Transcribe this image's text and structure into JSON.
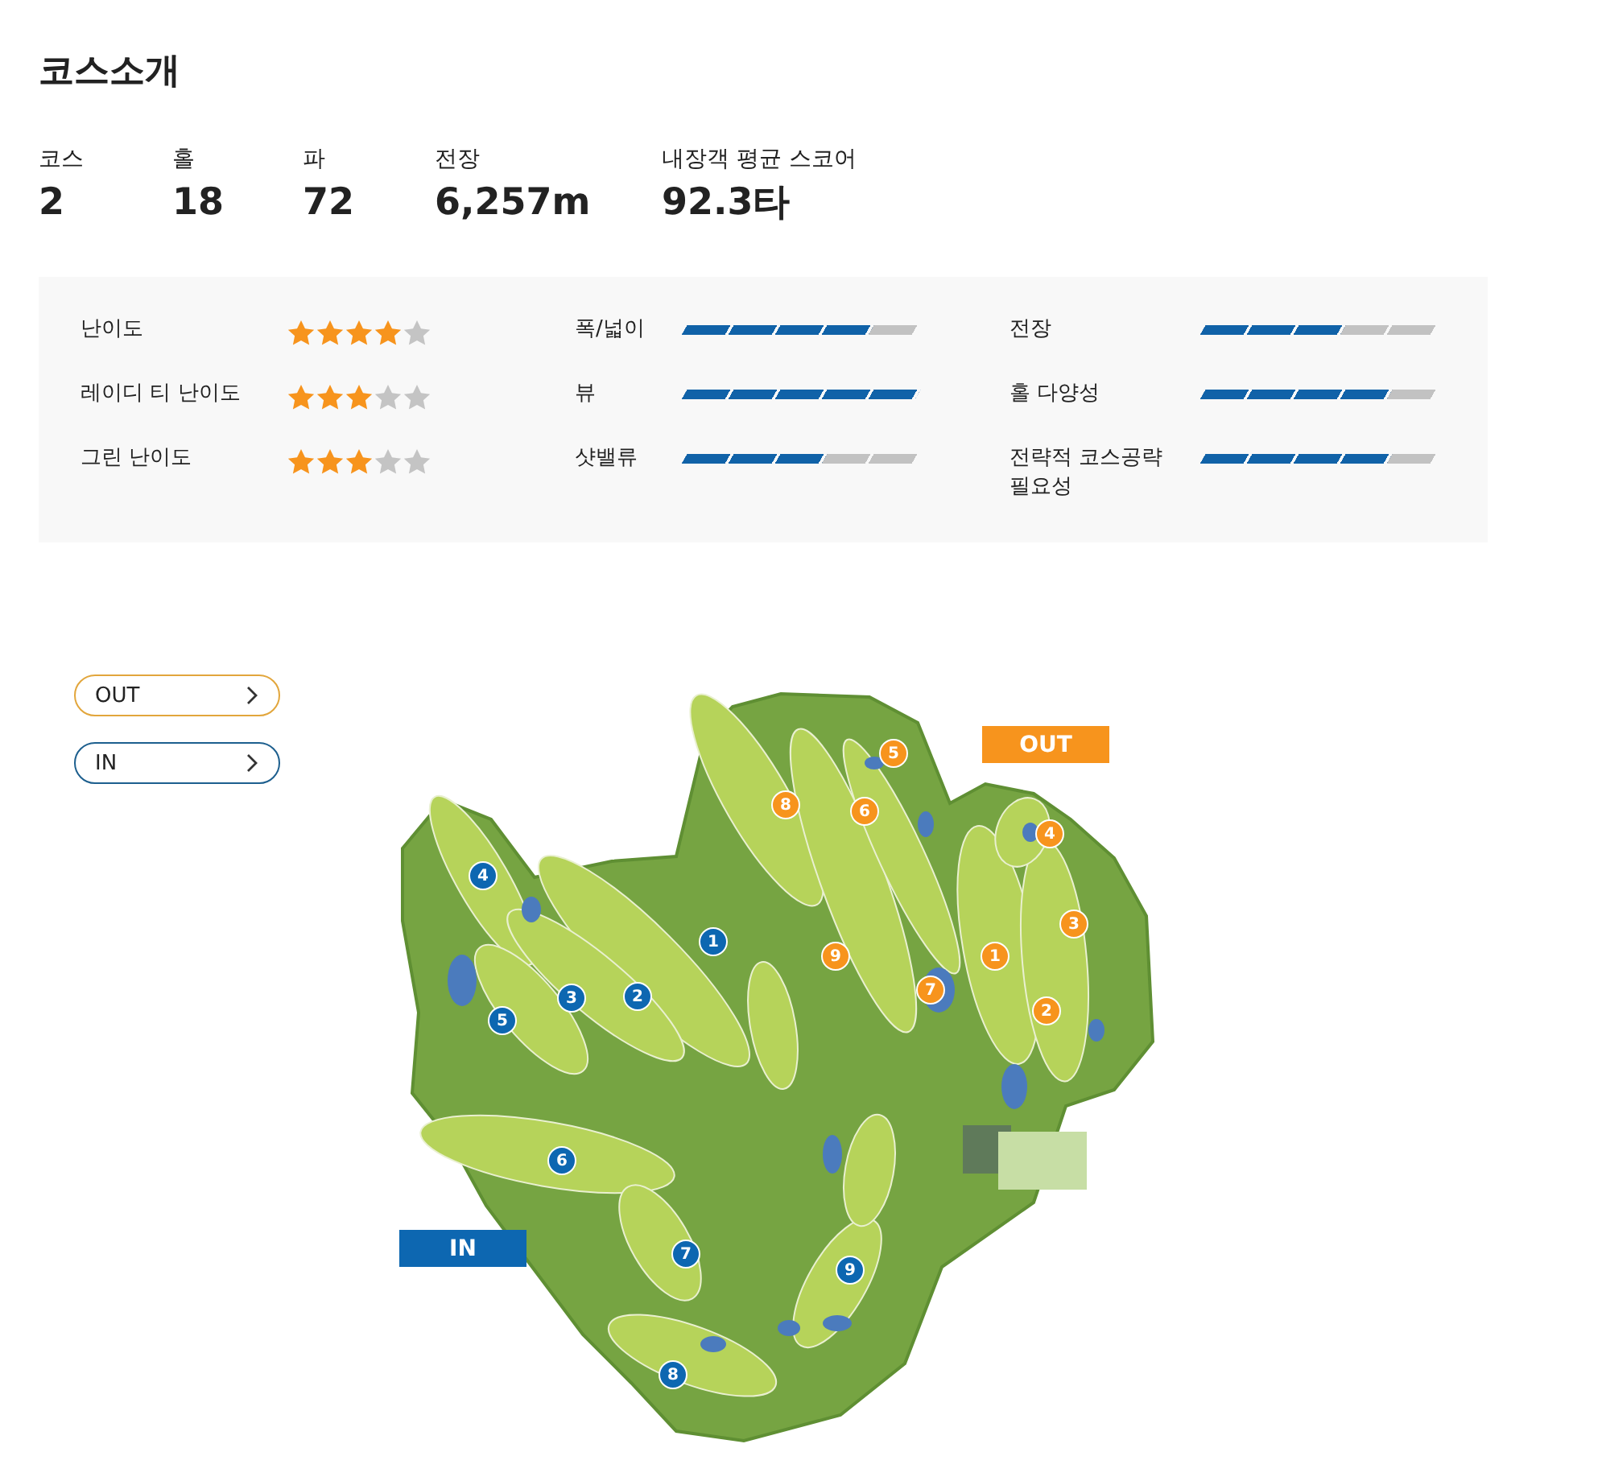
{
  "title": "코스소개",
  "stats": [
    {
      "label": "코스",
      "value": "2"
    },
    {
      "label": "홀",
      "value": "18"
    },
    {
      "label": "파",
      "value": "72"
    },
    {
      "label": "전장",
      "value": "6,257m"
    },
    {
      "label": "내장객 평균 스코어",
      "value": "92.3타"
    }
  ],
  "star_ratings": [
    {
      "label": "난이도",
      "stars": 4
    },
    {
      "label": "레이디 티 난이도",
      "stars": 3
    },
    {
      "label": "그린 난이도",
      "stars": 3
    }
  ],
  "features": [
    {
      "label": "폭/넓이",
      "level": 0.8
    },
    {
      "label": "뷰",
      "level": 1
    },
    {
      "label": "샷밸류",
      "level": 0.6
    }
  ],
  "factors": [
    {
      "label": "전장",
      "level": 0.6
    },
    {
      "label": "홀 다양성",
      "level": 0.8
    },
    {
      "label": "전략적 코스공략 필요성",
      "level": 0.8
    }
  ],
  "map": {
    "route_buttons": [
      {
        "label": "OUT",
        "color": "#e2a63c"
      },
      {
        "label": "IN",
        "color": "#1d5f8e"
      }
    ],
    "routes": [
      {
        "label": "OUT",
        "color": "#f7941d",
        "holes": [
          "1",
          "2",
          "3",
          "4",
          "5",
          "6",
          "7",
          "8",
          "9"
        ]
      },
      {
        "label": "IN",
        "color": "#0d67b1",
        "holes": [
          "1",
          "2",
          "3",
          "4",
          "5",
          "6",
          "7",
          "8",
          "9"
        ]
      }
    ]
  }
}
